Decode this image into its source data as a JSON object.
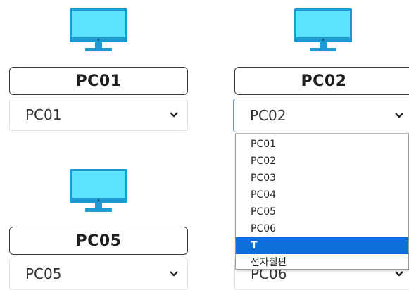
{
  "colors": {
    "monitor_screen": "#5ce1ff",
    "monitor_frame": "#1f9ad3",
    "dropdown_highlight": "#0a6fd8",
    "focus_border": "#5a9bd5"
  },
  "stations": [
    {
      "label": "PC01",
      "select_value": "PC01",
      "icon": "monitor-icon"
    },
    {
      "label": "PC02",
      "select_value": "PC02",
      "icon": "monitor-icon"
    },
    {
      "label": "PC05",
      "select_value": "PC05",
      "icon": "monitor-icon"
    },
    {
      "select_value": "PC06"
    }
  ],
  "dropdown": {
    "options": [
      "PC01",
      "PC02",
      "PC03",
      "PC04",
      "PC05",
      "PC06",
      "T",
      "전자칠판"
    ],
    "selected": "T"
  }
}
